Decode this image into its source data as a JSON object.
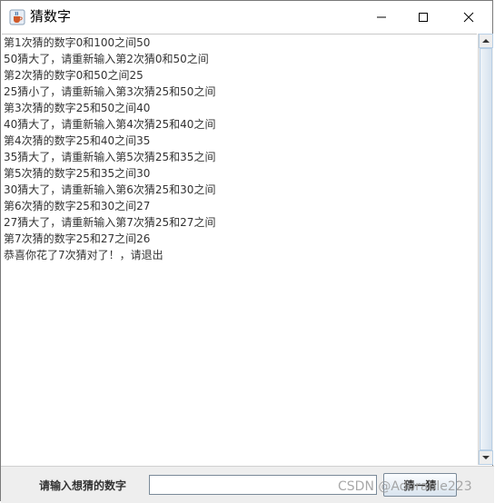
{
  "window": {
    "title": "猜数字",
    "icon": "java-cup-icon"
  },
  "log": {
    "lines": [
      "第1次猜的数字0和100之间50",
      "50猜大了，请重新输入第2次猜0和50之间",
      "第2次猜的数字0和50之间25",
      "25猜小了，请重新输入第3次猜25和50之间",
      "第3次猜的数字25和50之间40",
      "40猜大了，请重新输入第4次猜25和40之间",
      "第4次猜的数字25和40之间35",
      "35猜大了，请重新输入第5次猜25和35之间",
      "第5次猜的数字25和35之间30",
      "30猜大了，请重新输入第6次猜25和30之间",
      "第6次猜的数字25和30之间27",
      "27猜大了，请重新输入第7次猜25和27之间",
      "第7次猜的数字25和27之间26",
      "恭喜你花了7次猜对了！，请退出"
    ]
  },
  "form": {
    "prompt_label": "请输入想猜的数字",
    "input_value": "",
    "button_label": "猜一猜"
  },
  "watermark": "CSDN @Adorable223",
  "colors": {
    "text": "#333333",
    "panel": "#eeeeee",
    "scroll_border": "#b8cfe5"
  }
}
